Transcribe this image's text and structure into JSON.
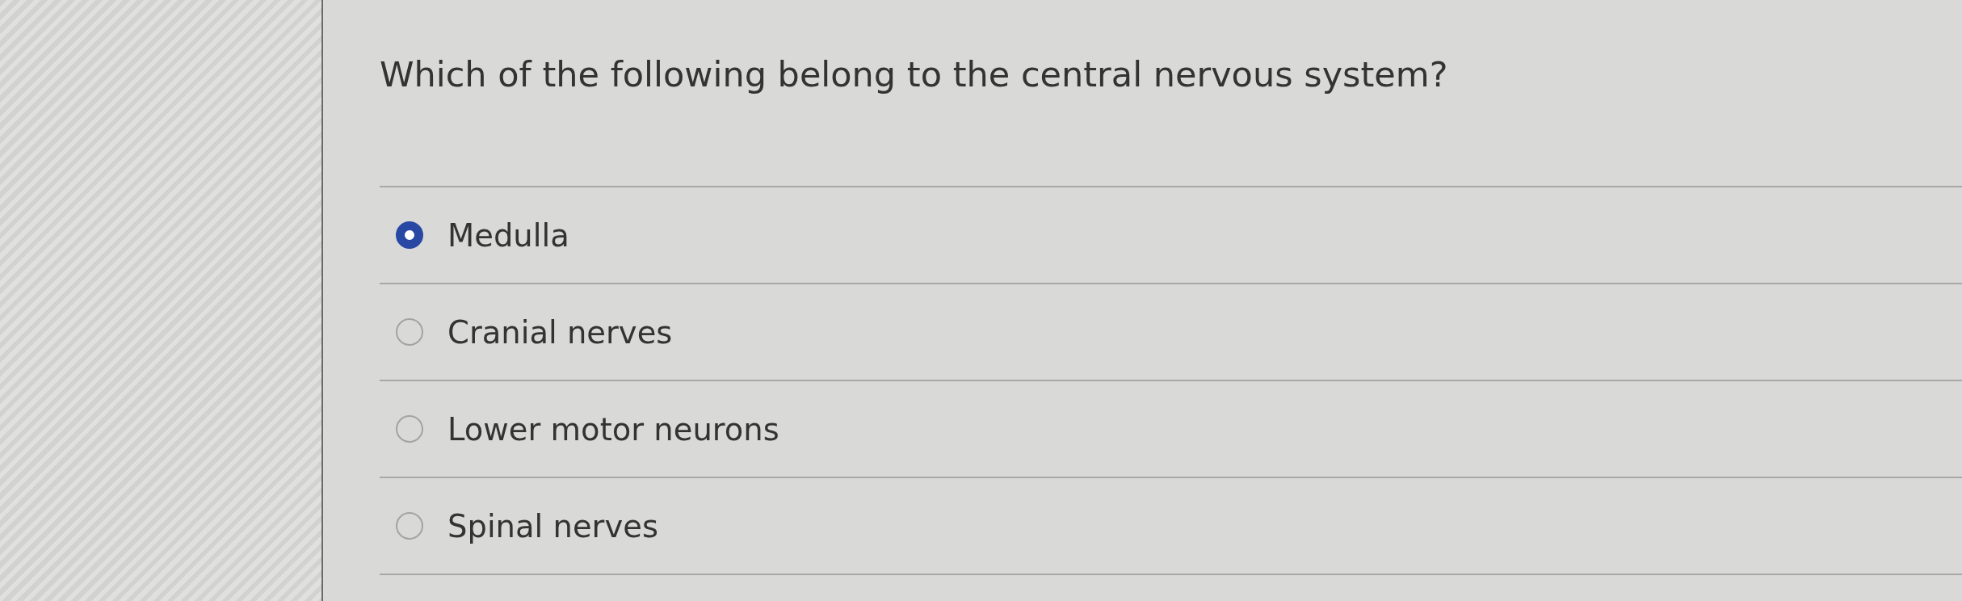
{
  "question": {
    "text": "Which of the following belong to the central nervous system?"
  },
  "options": [
    {
      "label": "Medulla",
      "selected": true
    },
    {
      "label": "Cranial nerves",
      "selected": false
    },
    {
      "label": "Lower motor neurons",
      "selected": false
    },
    {
      "label": "Spinal nerves",
      "selected": false
    }
  ]
}
